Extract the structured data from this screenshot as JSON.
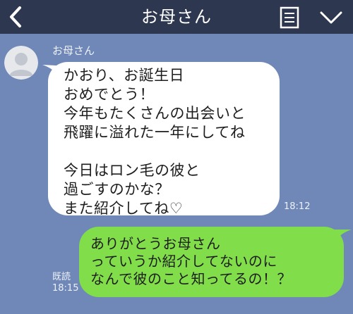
{
  "header": {
    "title": "お母さん",
    "back_icon": "chevron-left-icon",
    "menu_icon": "notes-icon",
    "expand_icon": "chevron-down-icon"
  },
  "incoming": {
    "sender": "お母さん",
    "avatar_icon": "default-avatar-icon",
    "text": "かおり、お誕生日\nおめでとう！\n今年もたくさんの出会いと\n飛躍に溢れた一年にしてね\n\n今日はロン毛の彼と\n過ごすのかな？\nまた紹介してね♡",
    "time": "18:12"
  },
  "outgoing": {
    "text": "ありがとうお母さん\nっていうか紹介してないのに\nなんで彼のこと知ってるの！？",
    "read_label": "既読",
    "time": "18:15"
  },
  "colors": {
    "background": "#6f88b8",
    "header": "#2e3750",
    "incoming_bubble": "#ffffff",
    "outgoing_bubble": "#81de4a"
  }
}
